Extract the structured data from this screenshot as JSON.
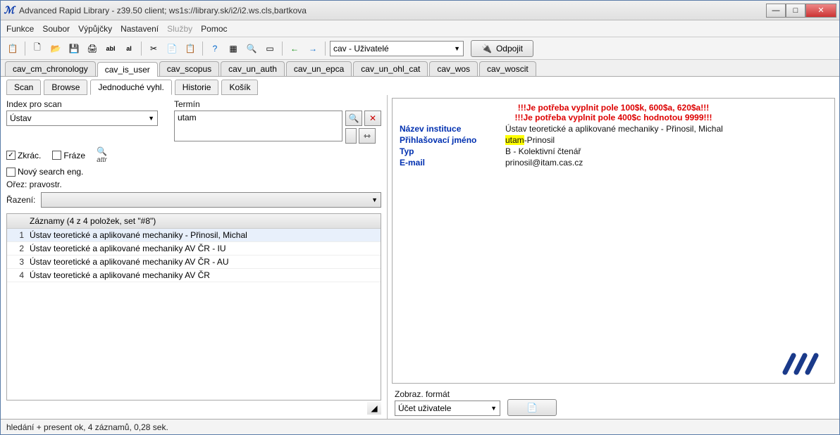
{
  "window": {
    "title": "Advanced Rapid Library - z39.50 client; ws1s://library.sk/i2/i2.ws.cls,bartkova"
  },
  "menu": {
    "items": [
      "Funkce",
      "Soubor",
      "Výpůjčky",
      "Nastavení",
      "Služby",
      "Pomoc"
    ],
    "disabled_index": 4
  },
  "toolbar": {
    "combo_label": "cav - Uživatelé",
    "disconnect": "Odpojit"
  },
  "tabs": {
    "items": [
      "cav_cm_chronology",
      "cav_is_user",
      "cav_scopus",
      "cav_un_auth",
      "cav_un_epca",
      "cav_un_ohl_cat",
      "cav_wos",
      "cav_woscit"
    ],
    "active_index": 1
  },
  "subtabs": {
    "items": [
      "Scan",
      "Browse",
      "Jednoduché vyhl.",
      "Historie",
      "Košík"
    ],
    "active_index": 2
  },
  "search": {
    "index_label": "Index pro scan",
    "index_value": "Ústav",
    "term_label": "Termín",
    "term_value": "utam",
    "cb_abbrev": "Zkrác.",
    "cb_phrase": "Fráze",
    "cb_newengine": "Nový search eng.",
    "attr_text": "attr",
    "trim_label": "Ořez: pravostr.",
    "sort_label": "Řazení:"
  },
  "records": {
    "header": "Záznamy (4 z 4 položek, set \"#8\")",
    "rows": [
      "Ústav teoretické a aplikované mechaniky - Přinosil, Michal",
      "Ústav teoretické a aplikované mechaniky AV ČR - IU",
      "Ústav teoretické a aplikované mechaniky AV ČR - AU",
      "Ústav teoretické a aplikované mechaniky AV ČR"
    ],
    "selected_index": 0
  },
  "detail": {
    "warn1": "!!!Je potřeba vyplnit pole 100$k, 600$a, 620$a!!!",
    "warn2": "!!!Je potřeba vyplnit pole 400$c hodnotou 9999!!!",
    "fields": {
      "inst_label": "Název instituce",
      "inst_value": "Ústav teoretické a aplikované mechaniky - Přinosil, Michal",
      "login_label": "Přihlašovací jméno",
      "login_hilite": "utam",
      "login_rest": "-Prinosil",
      "type_label": "Typ",
      "type_value": "B - Kolektivní čtenář",
      "email_label": "E-mail",
      "email_value": "prinosil@itam.cas.cz"
    }
  },
  "display_format": {
    "label": "Zobraz. formát",
    "value": "Účet uživatele"
  },
  "statusbar": "hledání + present ok, 4 záznamů, 0,28 sek."
}
